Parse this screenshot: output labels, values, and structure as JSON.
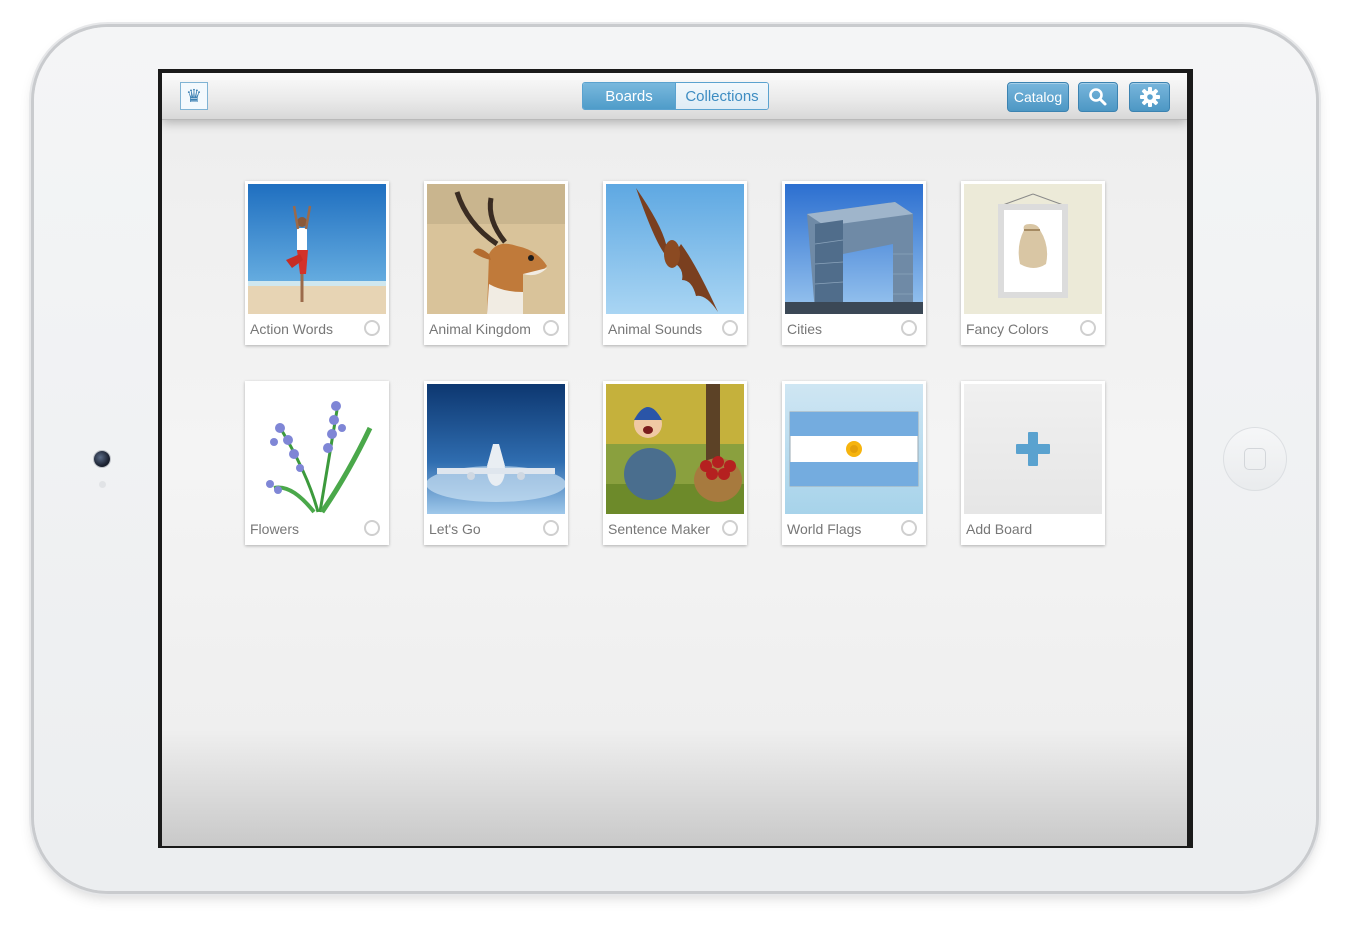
{
  "navbar": {
    "logo_icon": "chess-queen-icon",
    "tabs": [
      {
        "label": "Boards",
        "active": true
      },
      {
        "label": "Collections",
        "active": false
      }
    ],
    "catalog_label": "Catalog",
    "search_icon": "search-icon",
    "settings_icon": "gear-icon"
  },
  "boards": [
    {
      "label": "Action Words",
      "selected": false
    },
    {
      "label": "Animal Kingdom",
      "selected": false
    },
    {
      "label": "Animal Sounds",
      "selected": false
    },
    {
      "label": "Cities",
      "selected": false
    },
    {
      "label": "Fancy Colors",
      "selected": false
    },
    {
      "label": "Flowers",
      "selected": false
    },
    {
      "label": "Let's Go",
      "selected": false
    },
    {
      "label": "Sentence Maker",
      "selected": false
    },
    {
      "label": "World Flags",
      "selected": false
    }
  ],
  "add_board": {
    "label": "Add Board",
    "icon": "plus-icon"
  },
  "colors": {
    "accent": "#4f9cc9",
    "accent_light": "#79b8dd",
    "label_gray": "#777777"
  }
}
